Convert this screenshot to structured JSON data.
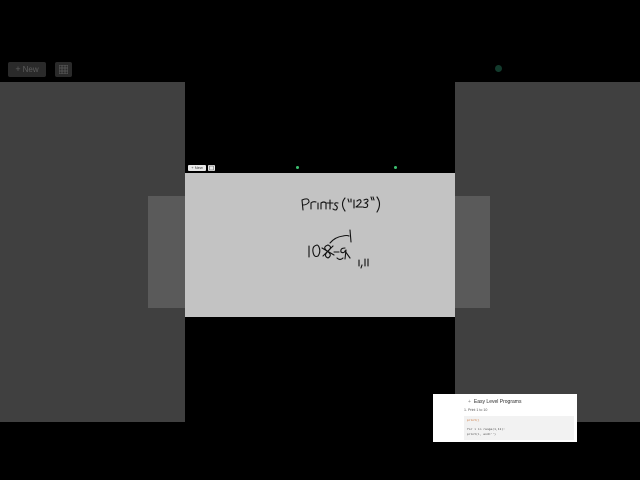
{
  "outer_toolbar": {
    "new_label": "New",
    "new_icon": "plus-icon",
    "grid_icon": "grid-icon"
  },
  "inner_toolbar": {
    "new_label": "+ New",
    "grid_icon": "grid-icon"
  },
  "slide": {
    "title": "Easy Level Programs",
    "bullet": "+",
    "subtitle": "1. Print 1 to 10",
    "code": [
      "print()",
      "for i in range(1,11):",
      "    print(i, end='')"
    ]
  },
  "handwriting": {
    "top": "Prints(\"123\")",
    "left_number": "10",
    "crossed": "8",
    "range_text": "0-9",
    "right_note": "1,11"
  },
  "colors": {
    "board": "#c3c3c3",
    "panel": "#404040",
    "status_dot": "#3cbf6f",
    "code_keyword": "#c86a2a"
  }
}
